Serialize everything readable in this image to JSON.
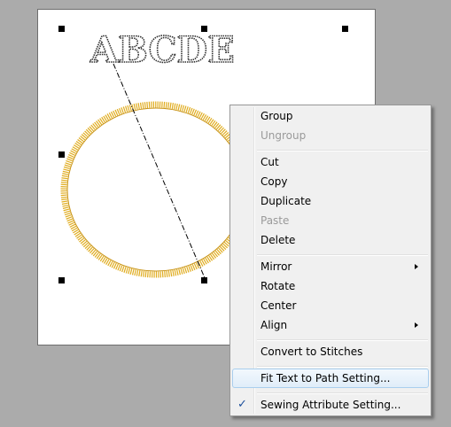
{
  "canvas": {
    "text_sample": "ABCDE"
  },
  "colors": {
    "ellipse_stitch": "#e0ac1e",
    "text_stitch": "#2f2f2f"
  },
  "context_menu": {
    "items": [
      {
        "label": "Group",
        "enabled": true
      },
      {
        "label": "Ungroup",
        "enabled": false
      },
      {
        "label": "Cut",
        "enabled": true
      },
      {
        "label": "Copy",
        "enabled": true
      },
      {
        "label": "Duplicate",
        "enabled": true
      },
      {
        "label": "Paste",
        "enabled": false
      },
      {
        "label": "Delete",
        "enabled": true
      },
      {
        "label": "Mirror",
        "enabled": true,
        "submenu": true
      },
      {
        "label": "Rotate",
        "enabled": true
      },
      {
        "label": "Center",
        "enabled": true
      },
      {
        "label": "Align",
        "enabled": true,
        "submenu": true
      },
      {
        "label": "Convert to Stitches",
        "enabled": true
      },
      {
        "label": "Fit Text to Path Setting...",
        "enabled": true,
        "highlighted": true
      },
      {
        "label": "Sewing Attribute Setting...",
        "enabled": true,
        "checked": true
      }
    ],
    "check_glyph": "✓"
  }
}
